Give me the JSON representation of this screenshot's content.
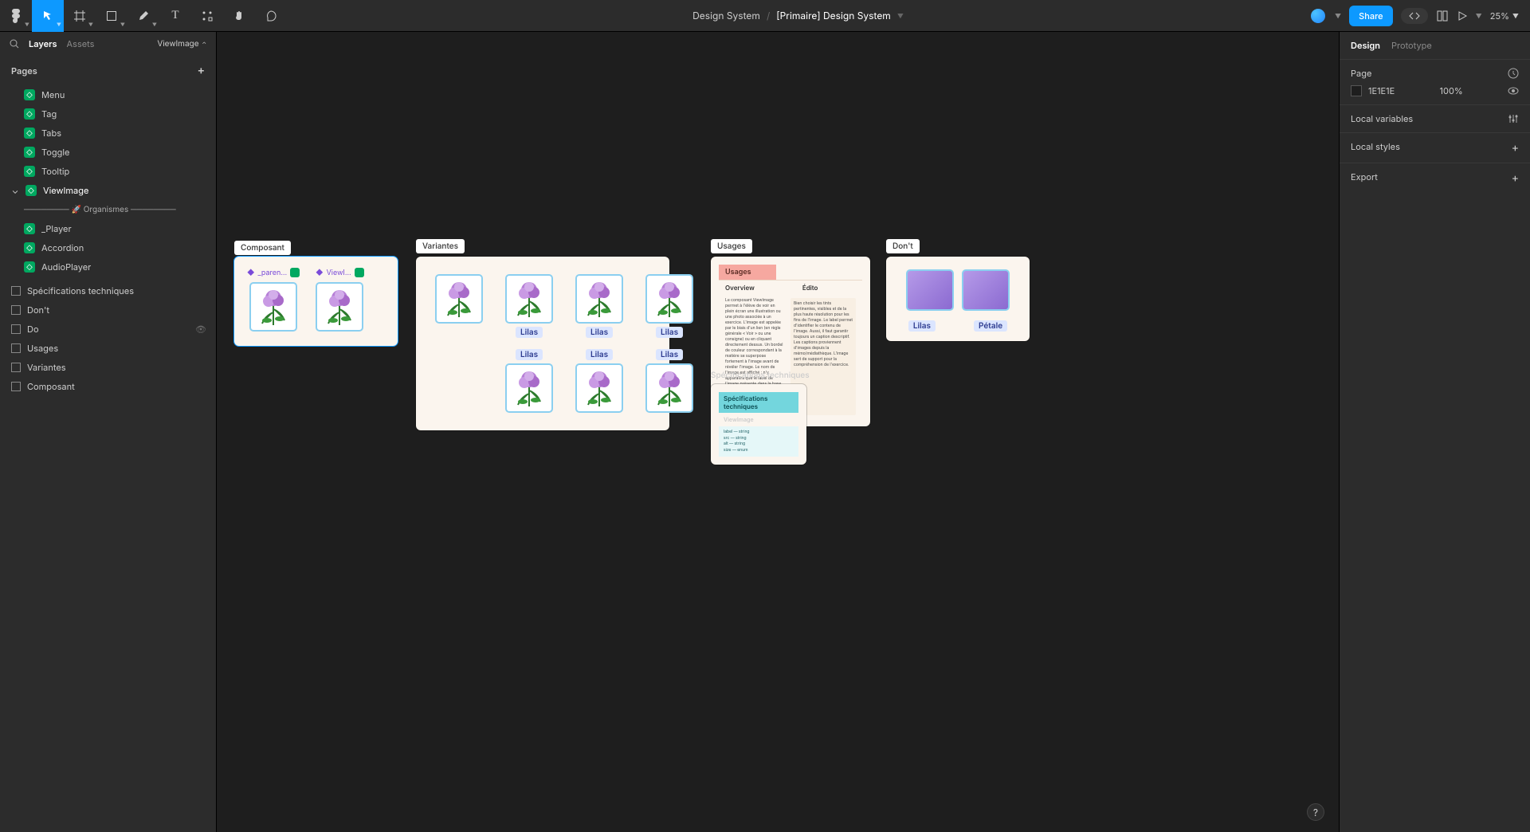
{
  "topbar": {
    "breadcrumb_root": "Design System",
    "breadcrumb_sep": "/",
    "breadcrumb_current": "[Primaire] Design System",
    "share": "Share",
    "zoom": "25%"
  },
  "leftPanel": {
    "tab_layers": "Layers",
    "tab_assets": "Assets",
    "page_chip": "ViewImage",
    "pages_header": "Pages",
    "layers": [
      {
        "label": "Menu"
      },
      {
        "label": "Tag"
      },
      {
        "label": "Tabs"
      },
      {
        "label": "Toggle"
      },
      {
        "label": "Tooltip"
      },
      {
        "label": "ViewImage",
        "selected": true,
        "open": true
      }
    ],
    "divider_label": "──────── 🚀 Organismes ────────",
    "layers2": [
      {
        "label": "_Player"
      },
      {
        "label": "Accordion"
      },
      {
        "label": "AudioPlayer"
      }
    ],
    "frames": [
      {
        "label": "Spécifications techniques"
      },
      {
        "label": "Don't"
      },
      {
        "label": "Do"
      },
      {
        "label": "Usages"
      },
      {
        "label": "Variantes"
      },
      {
        "label": "Composant"
      }
    ]
  },
  "rightPanel": {
    "tab_design": "Design",
    "tab_prototype": "Prototype",
    "sec_page": "Page",
    "bg_hex": "1E1E1E",
    "bg_opacity": "100%",
    "sec_localvars": "Local variables",
    "sec_localstyles": "Local styles",
    "sec_export": "Export"
  },
  "canvas": {
    "label_composant": "Composant",
    "label_variantes": "Variantes",
    "label_usages": "Usages",
    "label_dont": "Don't",
    "label_specs": "Spécifications techniques",
    "composant_chip1": "_paren…",
    "composant_chip2": "ViewI…",
    "caption_lilas": "Lilas",
    "caption_petale": "Pétale",
    "usages_header": "Usages",
    "usages_overview": "Overview",
    "usages_edito": "Édito",
    "specs_header": "Spécifications techniques",
    "specs_sub": "ViewImage"
  },
  "help": "?"
}
